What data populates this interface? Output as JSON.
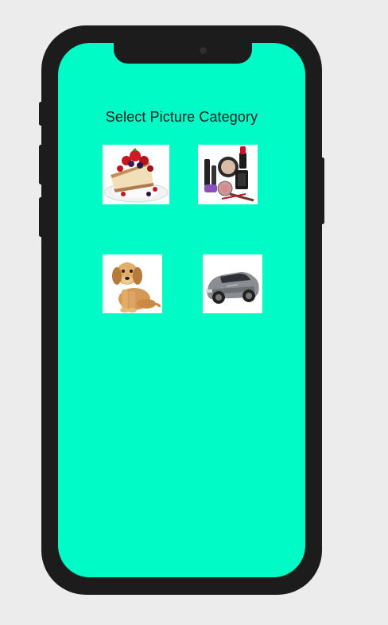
{
  "app": {
    "title": "Select Picture Category",
    "background_color": "#00fbc6"
  },
  "categories": [
    {
      "name": "cake",
      "icon": "cake-icon"
    },
    {
      "name": "makeup",
      "icon": "makeup-icon"
    },
    {
      "name": "dog",
      "icon": "dog-icon"
    },
    {
      "name": "car",
      "icon": "car-icon"
    }
  ]
}
